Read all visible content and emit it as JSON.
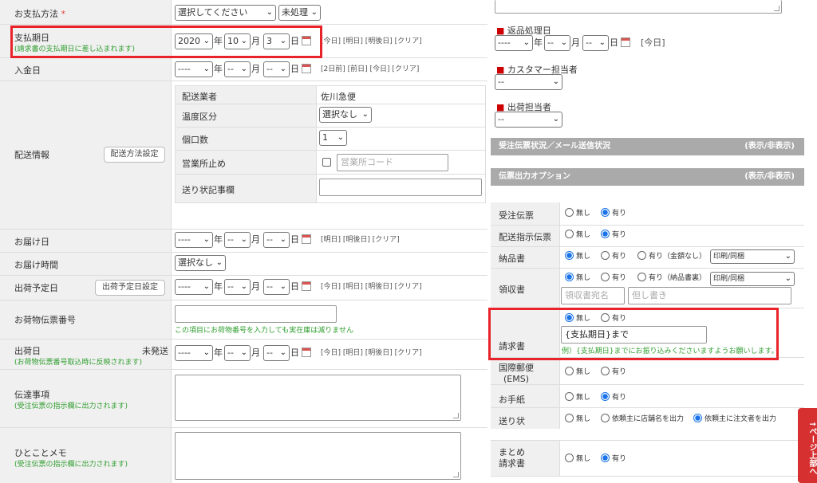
{
  "left": {
    "payment_method": {
      "label": "お支払方法",
      "req": "*",
      "select1": "選択してください",
      "select2": "未処理"
    },
    "due_date": {
      "label": "支払期日",
      "note": "(請求書の支払期日に差し込まれます)",
      "year": "2020",
      "month": "10",
      "day": "3",
      "year_unit": "年",
      "month_unit": "月",
      "day_unit": "日",
      "links": "[今日] [明日] [明後日] [クリア]"
    },
    "deposit_date": {
      "label": "入金日",
      "year": "----",
      "month": "--",
      "day": "--",
      "links": "[2日前] [前日] [今日] [クリア]"
    },
    "shipping": {
      "label": "配送情報",
      "button": "配送方法設定",
      "rows": [
        {
          "label": "配送業者",
          "value": "佐川急便"
        },
        {
          "label": "温度区分",
          "value": "選択なし"
        },
        {
          "label": "個口数",
          "value": "1"
        },
        {
          "label": "営業所止め",
          "value": "営業所コード"
        },
        {
          "label": "送り状記事欄",
          "value": ""
        }
      ]
    },
    "delivery_date": {
      "label": "お届け日",
      "year": "----",
      "month": "--",
      "day": "--",
      "links": "[明日] [明後日] [クリア]"
    },
    "delivery_time": {
      "label": "お届け時間",
      "value": "選択なし"
    },
    "ship_plan": {
      "label": "出荷予定日",
      "button": "出荷予定日設定",
      "year": "----",
      "month": "--",
      "day": "--",
      "links": "[今日] [明日] [明後日] [クリア]"
    },
    "tracking": {
      "label": "お荷物伝票番号",
      "note": "この項目にお荷物番号を入力しても実在庫は減りません"
    },
    "ship_date": {
      "label": "出荷日",
      "status": "未発送",
      "note": "(お荷物伝票番号取込時に反映されます)",
      "year": "----",
      "month": "--",
      "day": "--",
      "links": "[今日] [明日] [明後日] [クリア]"
    },
    "message": {
      "label": "伝達事項",
      "note": "(受注伝票の指示欄に出力されます)"
    },
    "memo": {
      "label": "ひとことメモ",
      "note": "(受注伝票の指示欄に出力されます)"
    }
  },
  "right": {
    "return": {
      "label": "返品処理日",
      "year": "----",
      "month": "--",
      "day": "--",
      "links": "[今日]"
    },
    "cs": {
      "label": "カスタマー担当者",
      "value": "--"
    },
    "shipper": {
      "label": "出荷担当者",
      "value": "--"
    },
    "bar1": {
      "title": "受注伝票状況／メール送信状況",
      "toggle": "(表示/非表示)"
    },
    "bar2": {
      "title": "伝票出力オプション",
      "toggle": "(表示/非表示)"
    },
    "options": {
      "none": "無し",
      "yes": "有り",
      "order_slip": "受注伝票",
      "delivery_slip": "配送指示伝票",
      "invoice_note": "納品書",
      "invoice_note_opt": "有り（金額なし）",
      "invoice_note_sel": "印刷/同梱",
      "receipt": "領収書",
      "receipt_opt": "有り（納品書裏）",
      "receipt_sel": "印刷/同梱",
      "receipt_ph1": "領収書宛名",
      "receipt_ph2": "但し書き",
      "bill": "請求書",
      "bill_value": "{支払期日}まで",
      "bill_note": "例）{支払期日}までにお振り込みくださいますようお願いします。",
      "ems": "国際郵便\n(EMS)",
      "letter": "お手紙",
      "label_slip": "送り状",
      "label_opt1": "依頼主に店舗名を出力",
      "label_opt2": "依頼主に注文者を出力",
      "summary": "まとめ\n請求書"
    }
  },
  "pagetop": "↑ページ上部へ",
  "colors": {
    "accent_red": "#e8232a",
    "note_green": "#2e9e2e",
    "radio_blue": "#1a73e8"
  }
}
